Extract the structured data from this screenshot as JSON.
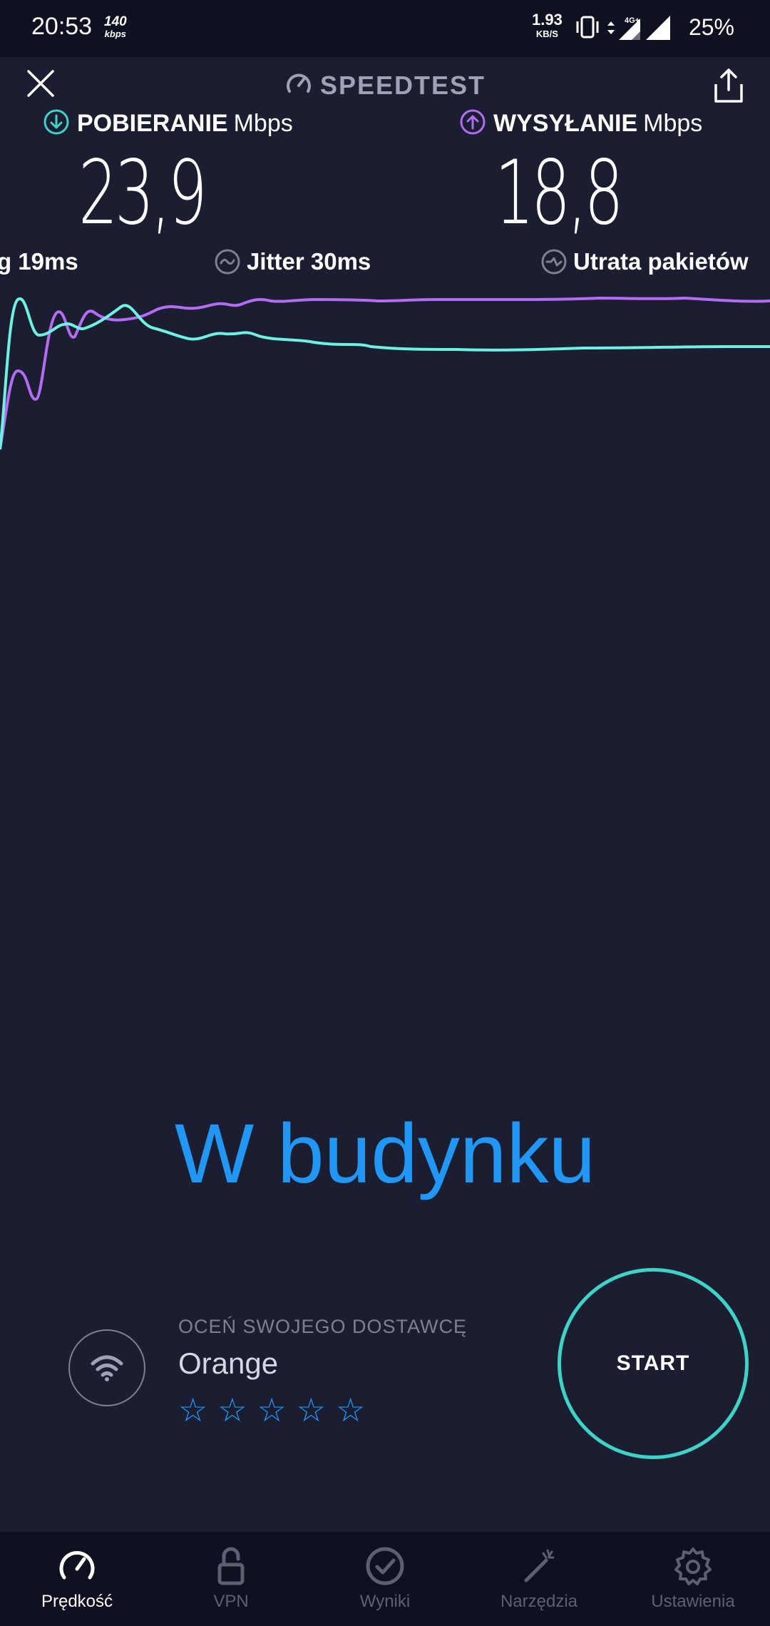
{
  "status_bar": {
    "time": "20:53",
    "data_rate": "140",
    "data_rate_unit": "kbps",
    "network_speed": "1.93",
    "network_speed_unit": "KB/S",
    "network_type": "4G+",
    "battery": "25%"
  },
  "header": {
    "title": "SPEEDTEST"
  },
  "download": {
    "label": "POBIERANIE",
    "unit": "Mbps",
    "value": "23,9",
    "color": "#3fd2c7"
  },
  "upload": {
    "label": "WYSYŁANIE",
    "unit": "Mbps",
    "value": "18,8",
    "color": "#b36cf2"
  },
  "stats": {
    "ping": "g 19ms",
    "jitter": "Jitter 30ms",
    "packet_loss": "Utrata pakietów"
  },
  "location": "W budynku",
  "provider": {
    "rate_label": "OCEŃ SWOJEGO DOSTAWCĘ",
    "name": "Orange",
    "stars": "☆☆☆☆☆",
    "star_count": 5
  },
  "start_button": "START",
  "bottom_nav": [
    {
      "label": "Prędkość",
      "icon": "speed-gauge-icon",
      "active": true
    },
    {
      "label": "VPN",
      "icon": "lock-icon",
      "active": false
    },
    {
      "label": "Wyniki",
      "icon": "check-circle-icon",
      "active": false
    },
    {
      "label": "Narzędzia",
      "icon": "magic-wand-icon",
      "active": false
    },
    {
      "label": "Ustawienia",
      "icon": "gear-icon",
      "active": false
    }
  ]
}
